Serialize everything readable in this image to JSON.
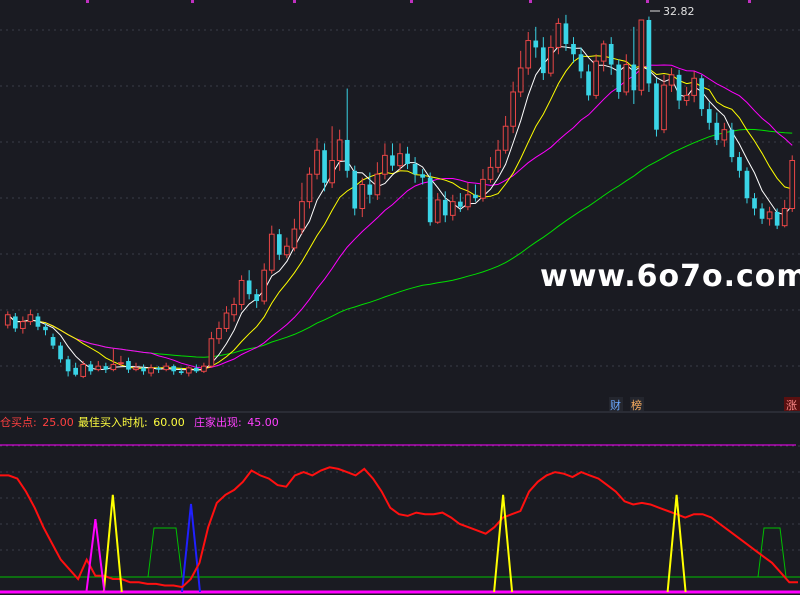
{
  "colors": {
    "background": "#1a1b22",
    "grid": "#3a3c48",
    "up": "#e84646",
    "down": "#3ad4e6",
    "ma5": "#ffffff",
    "ma10": "#ffff00",
    "ma20": "#ff00ff",
    "ma60": "#00e000",
    "indicator_red": "#ff1010",
    "indicator_green": "#00c000",
    "indicator_yellow": "#ffff00",
    "indicator_magenta": "#ff00ff",
    "indicator_blue": "#2020ff",
    "watermark": "#ffffff"
  },
  "watermark": "www.6o7o.com",
  "price_high_label": "32.82",
  "badges": {
    "finance": "财",
    "ranking": "榜",
    "rise": "涨"
  },
  "indicator_legend": [
    {
      "label": "仓买点:",
      "value": "25.00",
      "color": "#ff4040"
    },
    {
      "label": "最佳买入时机:",
      "value": "60.00",
      "color": "#ffff40"
    },
    {
      "label": "庄家出现:",
      "value": "45.00",
      "color": "#ff40ff"
    }
  ],
  "chart_data": [
    {
      "type": "candlestick",
      "title": "",
      "ylim": [
        11.5,
        33.5
      ],
      "candles": [
        [
          15.0,
          15.6,
          15.8,
          14.8
        ],
        [
          15.5,
          14.8,
          15.7,
          14.6
        ],
        [
          14.8,
          15.2,
          15.5,
          14.5
        ],
        [
          15.2,
          15.6,
          15.9,
          15.0
        ],
        [
          15.5,
          14.9,
          15.7,
          14.7
        ],
        [
          14.9,
          14.7,
          15.1,
          14.4
        ],
        [
          14.3,
          13.8,
          14.5,
          13.6
        ],
        [
          13.8,
          13.0,
          14.0,
          12.8
        ],
        [
          13.0,
          12.3,
          13.2,
          12.0
        ],
        [
          12.5,
          12.1,
          12.8,
          12.0
        ],
        [
          12.0,
          12.7,
          12.9,
          11.9
        ],
        [
          12.7,
          12.3,
          12.9,
          12.1
        ],
        [
          12.4,
          12.6,
          12.9,
          12.3
        ],
        [
          12.6,
          12.4,
          12.8,
          12.2
        ],
        [
          12.4,
          12.7,
          13.6,
          12.3
        ],
        [
          12.8,
          12.8,
          13.2,
          12.6
        ],
        [
          12.9,
          12.4,
          13.1,
          12.2
        ],
        [
          12.4,
          12.5,
          12.8,
          12.3
        ],
        [
          12.5,
          12.3,
          12.7,
          12.1
        ],
        [
          12.2,
          12.5,
          12.7,
          12.0
        ],
        [
          12.5,
          12.4,
          12.6,
          12.2
        ],
        [
          12.4,
          12.6,
          12.8,
          12.3
        ],
        [
          12.6,
          12.3,
          12.7,
          12.1
        ],
        [
          12.3,
          12.2,
          12.5,
          12.1
        ],
        [
          12.2,
          12.5,
          12.6,
          12.0
        ],
        [
          12.5,
          12.3,
          12.7,
          12.2
        ],
        [
          12.3,
          12.6,
          12.8,
          12.2
        ],
        [
          12.6,
          14.2,
          14.6,
          12.5
        ],
        [
          14.2,
          14.8,
          15.2,
          13.9
        ],
        [
          14.8,
          15.7,
          16.1,
          14.6
        ],
        [
          15.6,
          16.2,
          16.6,
          15.2
        ],
        [
          16.2,
          17.6,
          17.9,
          15.9
        ],
        [
          17.6,
          16.8,
          18.2,
          16.5
        ],
        [
          16.8,
          16.4,
          17.1,
          16.0
        ],
        [
          16.4,
          18.2,
          18.6,
          16.2
        ],
        [
          18.2,
          20.3,
          20.8,
          18.0
        ],
        [
          20.3,
          19.1,
          20.6,
          18.8
        ],
        [
          19.1,
          19.6,
          20.1,
          18.9
        ],
        [
          19.5,
          20.6,
          21.2,
          19.3
        ],
        [
          20.6,
          22.2,
          23.3,
          20.3
        ],
        [
          22.2,
          23.8,
          24.2,
          21.8
        ],
        [
          23.8,
          25.2,
          25.9,
          23.5
        ],
        [
          25.2,
          23.3,
          25.6,
          22.8
        ],
        [
          23.3,
          24.6,
          26.6,
          23.0
        ],
        [
          24.6,
          25.8,
          26.4,
          24.0
        ],
        [
          25.8,
          24.0,
          28.8,
          23.6
        ],
        [
          24.0,
          21.8,
          24.3,
          21.4
        ],
        [
          21.8,
          23.2,
          23.6,
          21.3
        ],
        [
          23.2,
          22.6,
          23.9,
          22.1
        ],
        [
          22.6,
          23.8,
          24.5,
          22.3
        ],
        [
          23.8,
          24.9,
          25.6,
          23.5
        ],
        [
          24.9,
          24.3,
          25.6,
          24.0
        ],
        [
          24.3,
          25.0,
          25.6,
          24.0
        ],
        [
          25.0,
          24.4,
          25.4,
          24.1
        ],
        [
          24.4,
          23.8,
          24.8,
          23.3
        ],
        [
          23.8,
          23.6,
          24.1,
          23.2
        ],
        [
          23.6,
          21.0,
          23.9,
          20.8
        ],
        [
          21.0,
          22.3,
          22.7,
          20.9
        ],
        [
          22.3,
          21.4,
          22.8,
          21.0
        ],
        [
          21.4,
          22.2,
          22.6,
          21.1
        ],
        [
          22.2,
          21.9,
          22.7,
          21.6
        ],
        [
          21.9,
          22.6,
          23.3,
          21.7
        ],
        [
          22.6,
          22.4,
          23.2,
          22.2
        ],
        [
          22.4,
          23.5,
          24.1,
          22.2
        ],
        [
          23.5,
          24.2,
          24.8,
          23.3
        ],
        [
          24.2,
          25.2,
          25.8,
          23.9
        ],
        [
          25.2,
          26.6,
          27.2,
          25.0
        ],
        [
          26.6,
          28.6,
          29.2,
          26.2
        ],
        [
          28.6,
          30.0,
          31.0,
          28.3
        ],
        [
          30.0,
          31.6,
          32.1,
          29.6
        ],
        [
          31.6,
          31.2,
          32.4,
          30.6
        ],
        [
          31.2,
          29.7,
          31.8,
          29.3
        ],
        [
          29.7,
          31.2,
          31.9,
          29.5
        ],
        [
          31.2,
          32.6,
          32.9,
          30.8
        ],
        [
          32.6,
          31.4,
          33.1,
          31.0
        ],
        [
          31.4,
          30.8,
          31.8,
          30.3
        ],
        [
          30.8,
          29.8,
          31.2,
          29.4
        ],
        [
          29.8,
          28.4,
          30.2,
          28.1
        ],
        [
          28.4,
          30.4,
          30.8,
          28.2
        ],
        [
          30.4,
          31.4,
          31.6,
          29.8
        ],
        [
          31.4,
          30.2,
          31.8,
          29.6
        ],
        [
          30.2,
          28.6,
          30.5,
          28.2
        ],
        [
          28.6,
          30.2,
          30.8,
          28.4
        ],
        [
          30.2,
          28.7,
          32.4,
          27.9
        ],
        [
          28.7,
          32.8,
          32.8,
          28.4
        ],
        [
          32.8,
          29.1,
          33.0,
          28.6
        ],
        [
          29.1,
          26.4,
          29.4,
          26.0
        ],
        [
          26.4,
          29.0,
          29.6,
          26.2
        ],
        [
          29.0,
          29.6,
          30.0,
          28.6
        ],
        [
          29.6,
          28.1,
          29.9,
          27.6
        ],
        [
          28.1,
          28.4,
          28.9,
          27.8
        ],
        [
          28.4,
          29.4,
          29.8,
          28.0
        ],
        [
          29.4,
          27.6,
          29.6,
          27.2
        ],
        [
          27.6,
          26.8,
          28.0,
          26.4
        ],
        [
          26.8,
          25.8,
          27.4,
          25.5
        ],
        [
          25.8,
          26.4,
          26.8,
          25.4
        ],
        [
          26.4,
          24.8,
          26.8,
          24.5
        ],
        [
          24.8,
          24.0,
          25.1,
          23.6
        ],
        [
          24.0,
          22.4,
          24.2,
          22.1
        ],
        [
          22.4,
          21.8,
          22.7,
          21.4
        ],
        [
          21.8,
          21.2,
          22.1,
          20.9
        ],
        [
          21.2,
          21.6,
          21.9,
          20.8
        ],
        [
          21.6,
          20.8,
          21.8,
          20.6
        ],
        [
          20.8,
          21.8,
          22.3,
          20.7
        ],
        [
          21.8,
          24.6,
          24.9,
          21.6
        ]
      ]
    },
    {
      "type": "line",
      "title": "",
      "ylim": [
        0,
        100
      ],
      "series": [
        {
          "name": "仓买点",
          "color": "#ff1010",
          "values": [
            72,
            72,
            70,
            62,
            52,
            40,
            30,
            20,
            14,
            8,
            20,
            10,
            10,
            8,
            8,
            6,
            6,
            5,
            5,
            4,
            4,
            3,
            8,
            18,
            40,
            55,
            60,
            63,
            68,
            75,
            72,
            70,
            66,
            65,
            72,
            74,
            72,
            75,
            77,
            76,
            74,
            72,
            76,
            70,
            62,
            52,
            48,
            47,
            49,
            48,
            48,
            49,
            46,
            42,
            40,
            38,
            36,
            40,
            46,
            48,
            50,
            62,
            68,
            72,
            74,
            73,
            71,
            74,
            72,
            70,
            66,
            62,
            56,
            54,
            55,
            54,
            52,
            50,
            48,
            46,
            48,
            48,
            46,
            42,
            38,
            34,
            30,
            26,
            22,
            18,
            12,
            6,
            6
          ]
        },
        {
          "name": "最佳买入时机",
          "color": "#ffff00",
          "values": [
            0,
            0,
            0,
            0,
            0,
            0,
            0,
            0,
            0,
            0,
            0,
            0,
            0,
            60,
            0,
            0,
            0,
            0,
            0,
            0,
            0,
            0,
            0,
            0,
            0,
            0,
            0,
            0,
            0,
            0,
            0,
            0,
            0,
            0,
            0,
            0,
            0,
            0,
            0,
            0,
            0,
            0,
            0,
            0,
            0,
            0,
            0,
            0,
            0,
            0,
            0,
            0,
            0,
            0,
            0,
            0,
            0,
            0,
            60,
            0,
            0,
            0,
            0,
            0,
            0,
            0,
            0,
            0,
            0,
            0,
            0,
            0,
            0,
            0,
            0,
            0,
            0,
            0,
            60,
            0,
            0,
            0,
            0,
            0,
            0,
            0,
            0,
            0,
            0,
            0,
            0,
            0,
            0,
            0,
            0,
            0,
            60
          ]
        },
        {
          "name": "庄家出现",
          "color": "#ff00ff",
          "values": [
            0,
            0,
            0,
            0,
            0,
            0,
            0,
            0,
            0,
            0,
            0,
            45,
            0,
            0,
            0,
            0,
            0,
            0,
            0,
            0,
            0,
            0,
            0,
            0,
            0,
            0,
            0,
            0,
            0,
            0,
            0,
            0,
            0,
            0,
            0,
            0,
            0,
            0,
            0,
            0,
            0,
            0,
            0,
            0,
            0,
            0,
            0,
            0,
            0,
            0,
            0,
            0,
            0,
            0,
            0,
            0,
            0,
            0,
            0,
            0,
            0,
            0,
            0,
            0,
            0,
            0,
            0,
            0,
            0,
            0,
            0,
            0,
            0,
            0,
            0,
            0,
            0,
            0,
            0,
            0,
            0,
            0,
            0,
            0,
            0,
            0,
            0,
            0,
            0,
            0,
            0,
            0,
            0,
            0,
            0,
            0,
            45,
            0,
            0
          ]
        }
      ]
    }
  ]
}
